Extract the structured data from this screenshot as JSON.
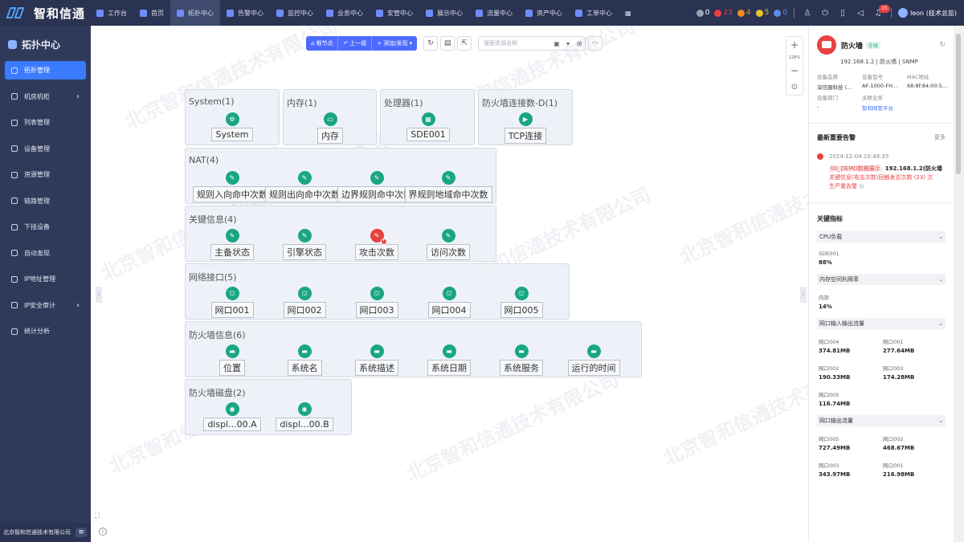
{
  "brand": {
    "name": "智和信通"
  },
  "nav": [
    {
      "label": "工作台",
      "active": false
    },
    {
      "label": "首页",
      "active": false
    },
    {
      "label": "拓扑中心",
      "active": true
    },
    {
      "label": "告警中心",
      "active": false
    },
    {
      "label": "监控中心",
      "active": false
    },
    {
      "label": "业务中心",
      "active": false
    },
    {
      "label": "安管中心",
      "active": false
    },
    {
      "label": "展示中心",
      "active": false
    },
    {
      "label": "流量中心",
      "active": false
    },
    {
      "label": "资产中心",
      "active": false
    },
    {
      "label": "工单中心",
      "active": false
    }
  ],
  "status_counts": [
    {
      "value": "0",
      "color": "#9aa3b5"
    },
    {
      "value": "23",
      "color": "#e94242"
    },
    {
      "value": "4",
      "color": "#f08a24"
    },
    {
      "value": "5",
      "color": "#e6c229"
    },
    {
      "value": "0",
      "color": "#5a8dee"
    }
  ],
  "notifications_count": "15",
  "user": {
    "name": "leon (技术总监)"
  },
  "sidebar": {
    "title": "拓扑中心",
    "items": [
      {
        "label": "拓扑管理",
        "active": true,
        "has_arrow": false
      },
      {
        "label": "机房机柜",
        "active": false,
        "has_arrow": true
      },
      {
        "label": "列表管理",
        "active": false,
        "has_arrow": false
      },
      {
        "label": "设备管理",
        "active": false,
        "has_arrow": false
      },
      {
        "label": "资源管理",
        "active": false,
        "has_arrow": false
      },
      {
        "label": "链路管理",
        "active": false,
        "has_arrow": false
      },
      {
        "label": "下挂设备",
        "active": false,
        "has_arrow": false
      },
      {
        "label": "自动发现",
        "active": false,
        "has_arrow": false
      },
      {
        "label": "IP地址管理",
        "active": false,
        "has_arrow": false
      },
      {
        "label": "IP安全审计",
        "active": false,
        "has_arrow": true
      },
      {
        "label": "统计分析",
        "active": false,
        "has_arrow": false
      }
    ],
    "footer": "北京智和信通技术有限公司"
  },
  "toolbar": {
    "root_label": "根节点",
    "up_label": "上一级",
    "add_label": "添加/发现",
    "search_placeholder": "搜索资源名称"
  },
  "zoom": {
    "value": "126%"
  },
  "watermark": "北京智和信通技术有限公司",
  "groups": [
    {
      "title": "System(1)",
      "nodes": [
        {
          "label": "System",
          "icon": "gear-icon"
        }
      ]
    },
    {
      "title": "内存(1)",
      "nodes": [
        {
          "label": "内存",
          "icon": "memory-icon"
        }
      ]
    },
    {
      "title": "处理器(1)",
      "nodes": [
        {
          "label": "SDE001",
          "icon": "cpu-icon"
        }
      ]
    },
    {
      "title": "防火墙连接数-D(1)",
      "nodes": [
        {
          "label": "TCP连接",
          "icon": "play-icon"
        }
      ]
    },
    {
      "title": "NAT(4)",
      "nodes": [
        {
          "label": "规则入向命中次数",
          "icon": "edit-icon"
        },
        {
          "label": "规则出向命中次数",
          "icon": "edit-icon"
        },
        {
          "label": "边界规则命中次数",
          "icon": "edit-icon"
        },
        {
          "label": "界规则地域命中次数",
          "icon": "edit-icon"
        }
      ]
    },
    {
      "title": "关键信息(4)",
      "nodes": [
        {
          "label": "主备状态",
          "icon": "edit-icon"
        },
        {
          "label": "引擎状态",
          "icon": "edit-icon"
        },
        {
          "label": "攻击次数",
          "icon": "edit-icon",
          "alert": true
        },
        {
          "label": "访问次数",
          "icon": "edit-icon"
        }
      ]
    },
    {
      "title": "网络接口(5)",
      "nodes": [
        {
          "label": "网口001",
          "icon": "port-icon"
        },
        {
          "label": "网口002",
          "icon": "port-icon"
        },
        {
          "label": "网口003",
          "icon": "port-icon"
        },
        {
          "label": "网口004",
          "icon": "port-icon"
        },
        {
          "label": "网口005",
          "icon": "port-icon"
        }
      ]
    },
    {
      "title": "防火墙信息(6)",
      "nodes": [
        {
          "label": "位置",
          "icon": "mail-icon"
        },
        {
          "label": "系统名",
          "icon": "mail-icon"
        },
        {
          "label": "系统描述",
          "icon": "mail-icon"
        },
        {
          "label": "系统日期",
          "icon": "mail-icon"
        },
        {
          "label": "系统服务",
          "icon": "mail-icon"
        },
        {
          "label": "运行的时间",
          "icon": "mail-icon"
        }
      ]
    },
    {
      "title": "防火墙磁盘(2)",
      "nodes": [
        {
          "label": "displ...00.A",
          "icon": "disk-icon"
        },
        {
          "label": "displ...00.B",
          "icon": "disk-icon"
        }
      ]
    }
  ],
  "device": {
    "name": "防火墙",
    "tag": "在线",
    "subtitle": "192.168.1.2 | 防火墙 | SNMP",
    "fields": [
      {
        "k": "设备品牌",
        "v": "深信服科技 (..."
      },
      {
        "k": "设备型号",
        "v": "AF-1000-FH..."
      },
      {
        "k": "MAC地址",
        "v": "68:8f:84:00:5..."
      },
      {
        "k": "设备部门",
        "v": "-"
      },
      {
        "k": "关联业务",
        "v": "智和网管平台"
      }
    ]
  },
  "alarms": {
    "title": "最新重要告警",
    "more": "更多",
    "item": {
      "time": "2024-12-04 10:49:35",
      "source": "00_DEMO数据展示",
      "host": "192.168.1.2(防火墙",
      "line1": "关键信息(攻击次数)回触发总次数 (23) 次",
      "line2": "生严重告警",
      "icon": "warning-icon"
    }
  },
  "kpi": {
    "title": "关键指标",
    "sections": [
      {
        "name": "CPU负载",
        "cells": [
          {
            "name": "SDE001",
            "value": "88%"
          }
        ]
      },
      {
        "name": "内存空间利用率",
        "cells": [
          {
            "name": "内存",
            "value": "14%"
          }
        ]
      },
      {
        "name": "网口输入输出流量",
        "cells": [
          {
            "name": "网口004",
            "value": "374.81MB"
          },
          {
            "name": "网口001",
            "value": "277.64MB"
          },
          {
            "name": "网口002",
            "value": "190.33MB"
          },
          {
            "name": "网口003",
            "value": "174.28MB"
          },
          {
            "name": "网口005",
            "value": "116.74MB"
          }
        ]
      },
      {
        "name": "网口输出流量",
        "cells": [
          {
            "name": "网口005",
            "value": "727.49MB"
          },
          {
            "name": "网口002",
            "value": "468.67MB"
          },
          {
            "name": "网口003",
            "value": "343.97MB"
          },
          {
            "name": "网口001",
            "value": "216.98MB"
          }
        ]
      }
    ]
  }
}
